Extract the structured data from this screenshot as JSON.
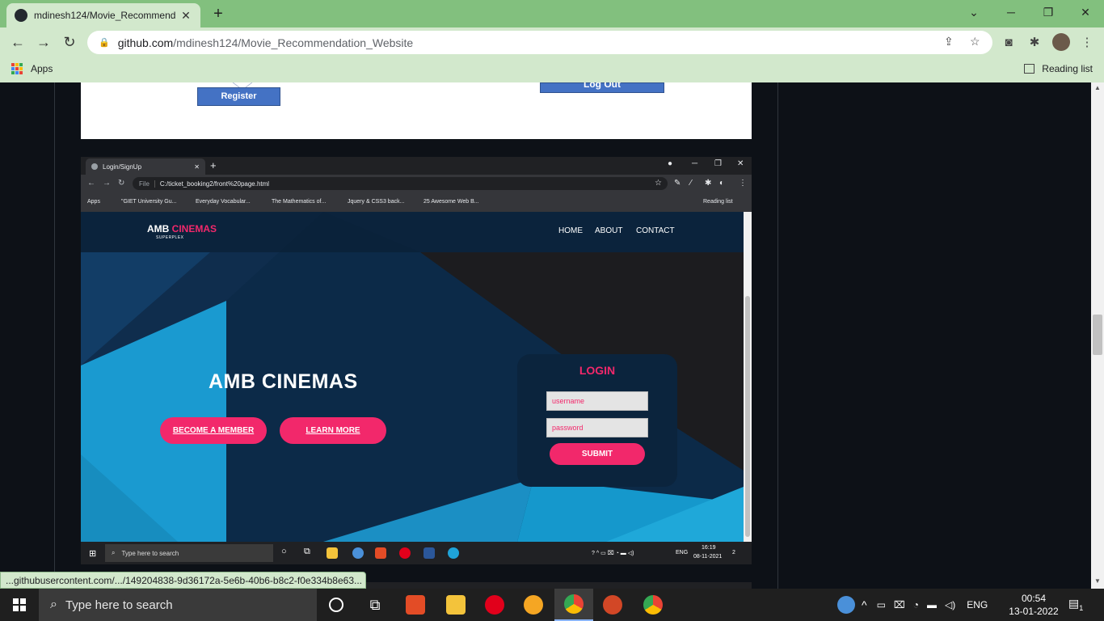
{
  "browser": {
    "tab_title": "mdinesh124/Movie_Recommend",
    "tab_close": "✕",
    "new_tab": "+",
    "url_domain": "github.com",
    "url_path": "/mdinesh124/Movie_Recommendation_Website",
    "bookmarks_apps": "Apps",
    "reading_list": "Reading list",
    "status_url": "...githubusercontent.com/.../149204838-9d36172a-5e6b-40b6-b8c2-f0e334b8e63..."
  },
  "diagram": {
    "register_label": "Register",
    "logout_label": "Log Out"
  },
  "screenshot": {
    "tab_title": "Login/SignUp",
    "url_scheme": "File",
    "url": "C:/ticket_booking2/front%20page.html",
    "bookmarks": [
      "Apps",
      "\"GIET University Gu...",
      "Everyday Vocabular...",
      "The Mathematics of...",
      "Jquery & CSS3 back...",
      "25 Awesome Web B..."
    ],
    "reading_list": "Reading list",
    "site": {
      "logo_main": "AMB",
      "logo_accent": "CINEMAS",
      "logo_sub": "SUPERPLEX",
      "nav": [
        "HOME",
        "ABOUT",
        "CONTACT"
      ],
      "hero_title": "AMB CINEMAS",
      "btn_member": "BECOME A MEMBER",
      "btn_learn": "LEARN MORE",
      "login_title": "LOGIN",
      "username_placeholder": "username",
      "password_placeholder": "password",
      "submit_label": "SUBMIT"
    },
    "taskbar": {
      "search": "Type here to search",
      "lang": "ENG",
      "time": "16:19",
      "date": "08-11-2021",
      "notif_count": "2"
    }
  },
  "taskbar": {
    "search_placeholder": "Type here to search",
    "lang": "ENG",
    "time": "00:54",
    "date": "13-01-2022",
    "notif_count": "1"
  },
  "colors": {
    "chrome_tabbar": "#82c07e",
    "chrome_toolbar": "#d2e8cc",
    "accent_pink": "#f2286b",
    "site_navy": "#0e2a47"
  }
}
